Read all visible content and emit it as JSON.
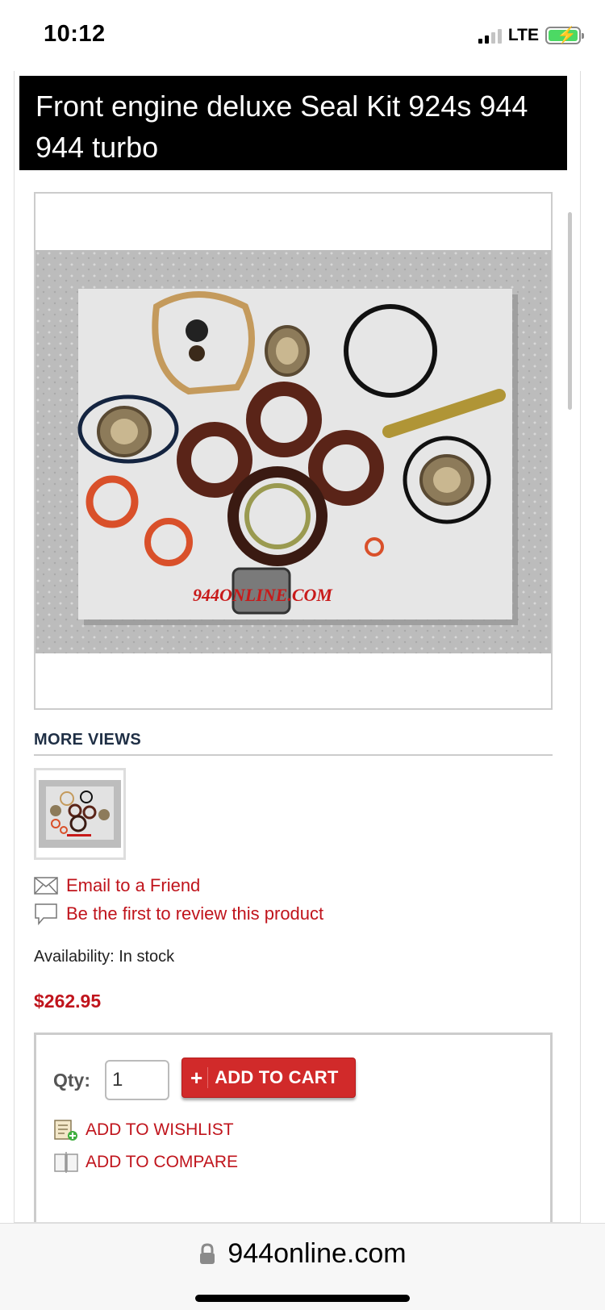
{
  "status_bar": {
    "time": "10:12",
    "network": "LTE"
  },
  "product": {
    "title": "Front engine deluxe Seal Kit 924s 944 944 turbo",
    "image_watermark": "944ONLINE.COM",
    "more_views_label": "MORE VIEWS",
    "email_link": "Email to a Friend",
    "review_link": "Be the first to review this product",
    "availability": "Availability: In stock",
    "price": "$262.95"
  },
  "cart": {
    "qty_label": "Qty:",
    "qty_value": "1",
    "add_to_cart_label": "ADD TO CART",
    "wishlist_label": "ADD TO WISHLIST",
    "compare_label": "ADD TO COMPARE"
  },
  "browser": {
    "url": "944online.com"
  },
  "colors": {
    "link_red": "#c0141c",
    "button_red": "#d12a2a",
    "title_bg": "#000000"
  }
}
